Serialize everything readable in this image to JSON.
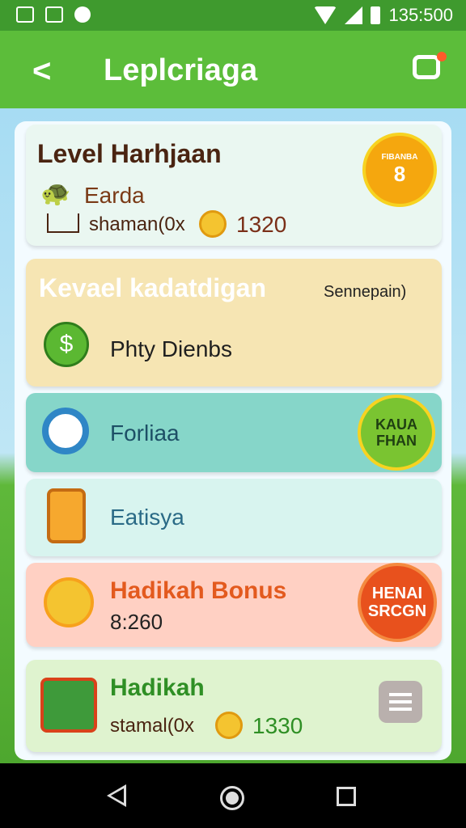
{
  "status_bar": {
    "time": "135:500",
    "icons": [
      "image-icon",
      "chart-icon",
      "circle-icon",
      "wifi-icon",
      "signal-icon",
      "battery-icon"
    ]
  },
  "app_bar": {
    "back_glyph": "<",
    "title": "Leplcriaga",
    "shop_icon": "shop-icon"
  },
  "cards": {
    "level": {
      "title": "Level Harhjaan",
      "subtitle": "Earda",
      "row_label": "shaman(0x",
      "coins": "1320",
      "badge_top": "FIBANBA",
      "badge_main": "8"
    },
    "event": {
      "title": "Kevael kadatdigan",
      "tag": "Sennepain)",
      "item": "Phty Dienbs"
    },
    "forliaa": {
      "label": "Forliaa",
      "badge": "KAUA FHAN"
    },
    "eatisya": {
      "label": "Eatisya"
    },
    "bonus": {
      "title": "Hadikah Bonus",
      "value": "8:260",
      "badge": "HENAI SRCGN"
    },
    "hadikah": {
      "title": "Hadikah",
      "row_label": "stamal(0x",
      "coins": "1330"
    }
  },
  "colors": {
    "green": "#5cbd3a",
    "orange": "#e35a1e",
    "brown": "#5a2a14",
    "coin": "#f4c430"
  },
  "nav_bar": {
    "icons": [
      "back-triangle-icon",
      "home-circle-icon",
      "recents-square-icon"
    ]
  }
}
